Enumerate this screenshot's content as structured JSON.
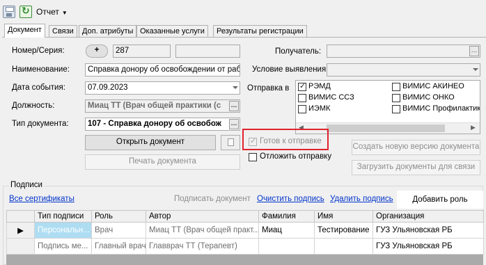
{
  "toolbar": {
    "save_icon": "save-icon",
    "refresh_icon": "refresh-icon",
    "report_label": "Отчет"
  },
  "tabs": [
    {
      "label": "Документ",
      "active": true
    },
    {
      "label": "Связи"
    },
    {
      "label": "Доп. атрибуты"
    },
    {
      "label": "Оказанные услуги"
    },
    {
      "label": "Результаты регистрации"
    }
  ],
  "form": {
    "number_label": "Номер/Серия:",
    "plus_label": "+",
    "number_value": "287",
    "series_value": "",
    "name_label": "Наименование:",
    "name_value": "Справка донору об освобождении от работ",
    "date_label": "Дата события:",
    "date_value": "07.09.2023",
    "position_label": "Должность:",
    "position_value": "Миац ТТ (Врач общей практики (с",
    "doctype_label": "Тип документа:",
    "doctype_value": "107 - Справка донору об освобож",
    "open_doc_button": "Открыть документ",
    "print_doc_button": "Печать документа",
    "recipient_label": "Получатель:",
    "recipient_value": "",
    "condition_label": "Условие выявления:",
    "condition_value": "",
    "send_to_label": "Отправка в",
    "send_targets": [
      {
        "label": "РЭМД",
        "checked": true
      },
      {
        "label": "ВИМИС АКИНЕО",
        "checked": false
      },
      {
        "label": "ВИМИС ССЗ",
        "checked": false
      },
      {
        "label": "ВИМИС ОНКО",
        "checked": false
      },
      {
        "label": "ИЭМК",
        "checked": false
      },
      {
        "label": "ВИМИС Профилактика",
        "checked": false
      }
    ],
    "ready_to_send_label": "Готов к отправке",
    "ready_to_send_checked": true,
    "postpone_label": "Отложить отправку",
    "postpone_checked": false,
    "new_version_button": "Создать новую версию документа",
    "load_docs_button": "Загрузить документы для связи"
  },
  "signatures": {
    "group_title": "Подписи",
    "all_certs_link": "Все сертификаты",
    "sign_doc_label": "Подписать документ",
    "clear_sign_link": "Очистить подпись",
    "delete_sign_link": "Удалить подпись",
    "add_role_button": "Добавить роль",
    "columns": [
      "Тип подписи",
      "Роль",
      "Автор",
      "Фамилия",
      "Имя",
      "Организация"
    ],
    "rows": [
      [
        "Персональн...",
        "Врач",
        "Миац ТТ (Врач общей практ...",
        "Миац",
        "Тестирование",
        "ГУЗ Ульяновская РБ"
      ],
      [
        "Подпись ме...",
        "Главный врач",
        "Главврач ТТ (Терапевт)",
        "",
        "",
        "ГУЗ Ульяновская РБ"
      ]
    ]
  }
}
